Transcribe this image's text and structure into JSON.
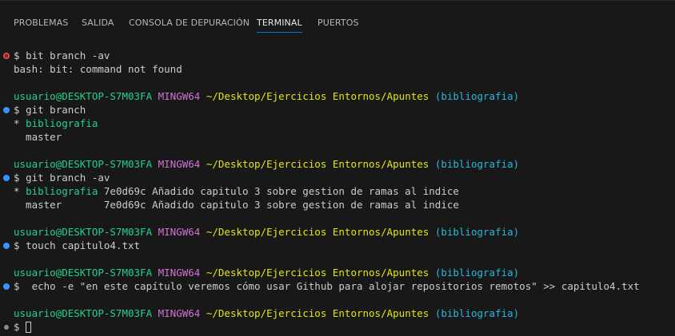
{
  "tabs": [
    {
      "label": "PROBLEMAS",
      "active": false
    },
    {
      "label": "SALIDA",
      "active": false
    },
    {
      "label": "CONSOLA DE DEPURACIÓN",
      "active": false
    },
    {
      "label": "TERMINAL",
      "active": true
    },
    {
      "label": "PUERTOS",
      "active": false
    }
  ],
  "prompt": {
    "user_host": "usuario@DESKTOP-S7M03FA",
    "system": "MINGW64",
    "path": "~/Desktop/Ejercicios Entornos/Apuntes",
    "branch": "(bibliografia)",
    "symbol": "$"
  },
  "terminal": {
    "cmd1": "bit branch -av",
    "out1": "bash: bit: command not found",
    "cmd2": "git branch",
    "out2_star": "* ",
    "out2_current": "bibliografia",
    "out2_other": "  master",
    "cmd3": "git branch -av",
    "out3_star": "* ",
    "out3_current": "bibliografia",
    "out3_rest": " 7e0d69c Añadido capitulo 3 sobre gestion de ramas al indice",
    "out3_line2": "  master       7e0d69c Añadido capitulo 3 sobre gestion de ramas al indice",
    "cmd4": "touch capitulo4.txt",
    "cmd5": " echo -e \"en este capítulo veremos cómo usar Github para alojar repositorios remotos\" >> capitulo4.txt"
  },
  "colors": {
    "background": "#181818",
    "user_host": "#23d18b",
    "system": "#d670d6",
    "path": "#e5e510",
    "branch": "#29b8db",
    "success_decoration": "#3794ff",
    "error_decoration": "#f14c4c",
    "active_tab_underline": "#0078d4"
  },
  "icons": {
    "command_success": "blue-dot-icon",
    "command_error": "red-circle-icon",
    "command_pending": "gray-dot-icon"
  }
}
